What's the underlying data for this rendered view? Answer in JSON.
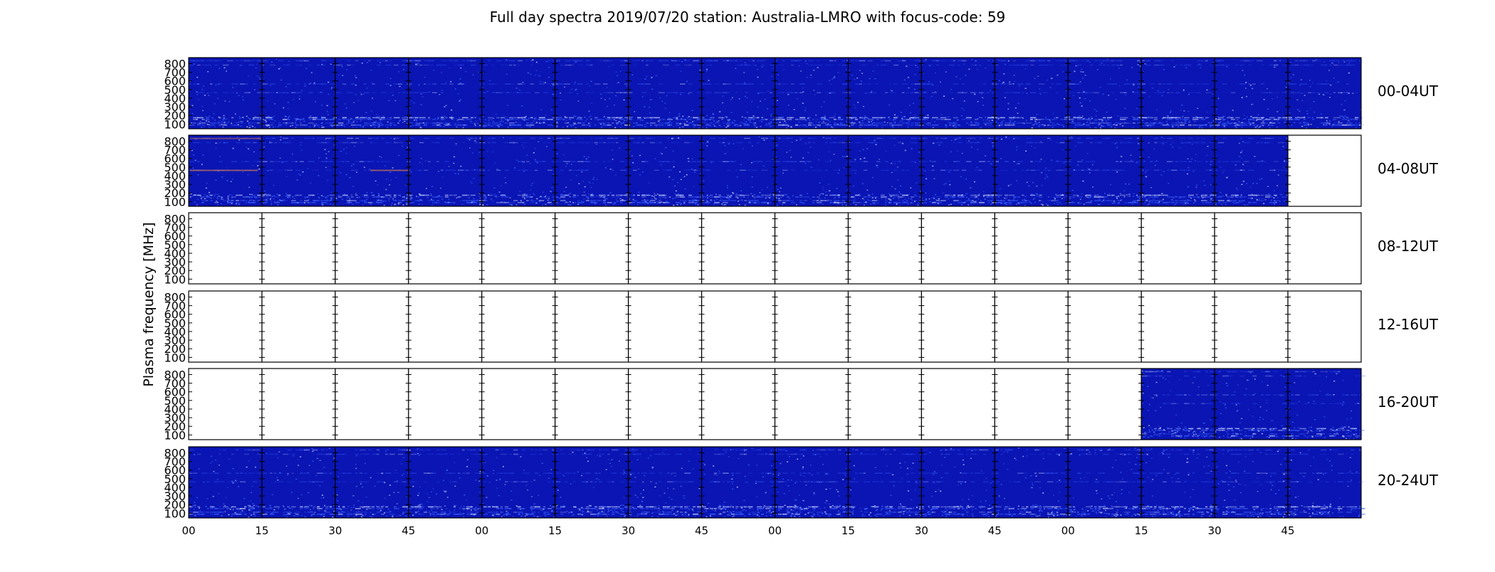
{
  "chart_data": {
    "type": "heatmap",
    "title": "Full day spectra 2019/07/20 station: Australia-LMRO with focus-code: 59",
    "ylabel": "Plasma frequency [MHz]",
    "xlabel": "",
    "ylim": [
      45,
      870
    ],
    "y_ticks": [
      100,
      200,
      300,
      400,
      500,
      600,
      700,
      800
    ],
    "x_tick_labels": [
      "00",
      "15",
      "30",
      "45",
      "00",
      "15",
      "30",
      "45",
      "00",
      "15",
      "30",
      "45",
      "00",
      "15",
      "30",
      "45"
    ],
    "segment_minutes": 15,
    "panels": [
      {
        "label": "00-04UT",
        "coverage": [
          0.0,
          1.0
        ]
      },
      {
        "label": "04-08UT",
        "coverage": [
          0.0,
          0.9375
        ]
      },
      {
        "label": "08-12UT",
        "coverage": []
      },
      {
        "label": "12-16UT",
        "coverage": []
      },
      {
        "label": "16-20UT",
        "coverage": [
          0.8125,
          1.0
        ]
      },
      {
        "label": "20-24UT",
        "coverage": [
          0.0,
          1.0
        ]
      }
    ],
    "colors": {
      "background": "#0a15b4",
      "noise_light": "#3c64ff",
      "noise_bright": "#c8d2ff",
      "band_highlight": "#ff8c32",
      "separator": "#000000"
    }
  }
}
